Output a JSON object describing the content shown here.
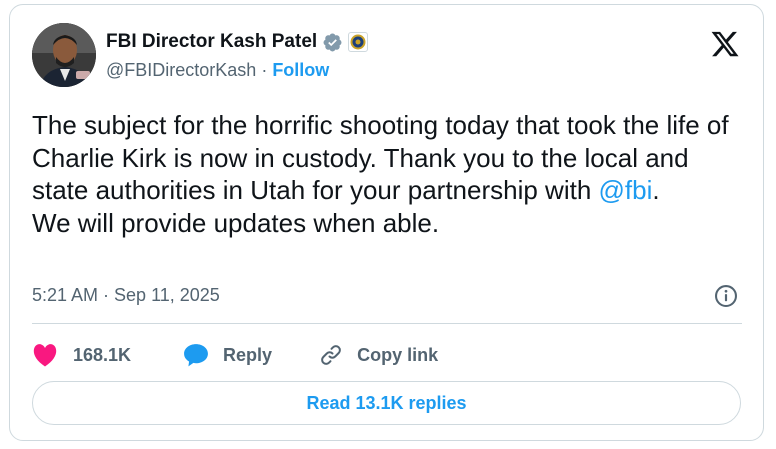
{
  "author": {
    "display_name": "FBI Director Kash Patel",
    "handle": "@FBIDirectorKash",
    "separator": "·",
    "follow_label": "Follow"
  },
  "tweet": {
    "text_before_mention": "The subject for the horrific shooting today that took the life of Charlie Kirk is now in custody. Thank you to the local and state authorities in Utah for your partnership with ",
    "mention": "@fbi",
    "text_after_mention": ".\nWe will provide updates when able.",
    "timestamp": "5:21 AM · Sep 11, 2025"
  },
  "actions": {
    "like_count": "168.1K",
    "reply_label": "Reply",
    "copy_link_label": "Copy link",
    "read_replies_label": "Read 13.1K replies"
  },
  "colors": {
    "accent": "#1d9bf0",
    "like": "#f91880",
    "text": "#0f1419",
    "muted": "#536471",
    "border": "#cfd9de"
  },
  "icons": {
    "verified": "verified-badge-icon",
    "affiliation": "fbi-seal-icon",
    "platform": "x-logo-icon",
    "info": "info-icon",
    "like": "heart-icon",
    "reply": "speech-bubble-icon",
    "copy_link": "link-icon"
  }
}
